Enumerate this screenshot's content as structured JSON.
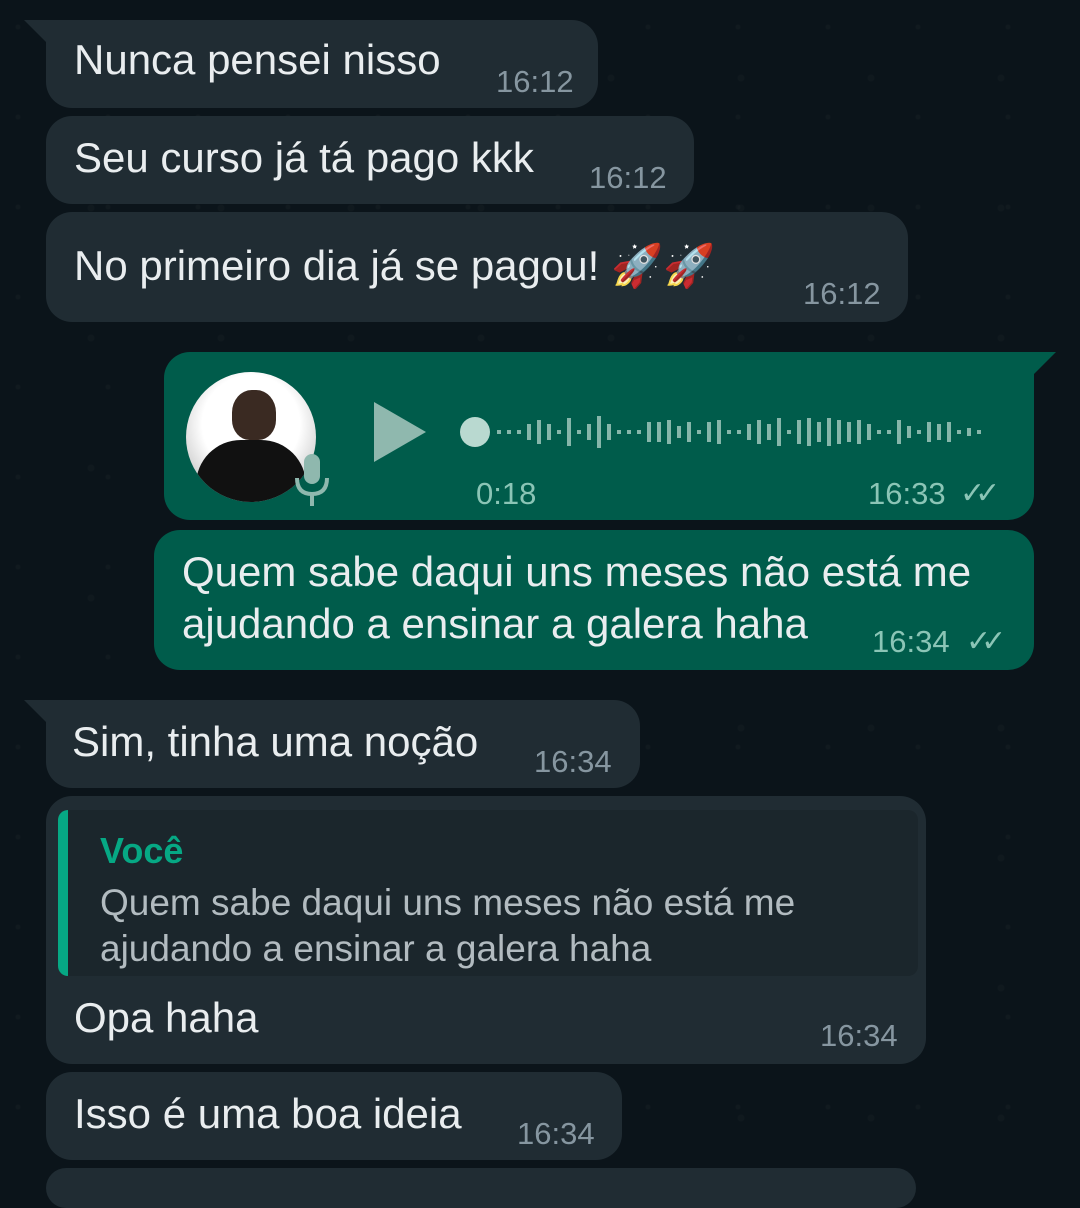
{
  "messages": {
    "m1": {
      "text": "Nunca pensei nisso",
      "time": "16:12"
    },
    "m2": {
      "text": "Seu curso já tá pago kkk",
      "time": "16:12"
    },
    "m3": {
      "text": "No primeiro dia já se pagou! 🚀🚀",
      "time": "16:12"
    },
    "voice": {
      "duration": "0:18",
      "time": "16:33",
      "status": "read"
    },
    "m4": {
      "line1": "Quem sabe daqui uns meses não está me",
      "line2": "ajudando a ensinar a galera haha",
      "time": "16:34",
      "status": "read"
    },
    "m5": {
      "text": "Sim, tinha uma noção",
      "time": "16:34"
    },
    "m6": {
      "reply_author": "Você",
      "reply_line1": "Quem sabe daqui uns meses não está me",
      "reply_line2": "ajudando a ensinar a galera haha",
      "text": "Opa haha",
      "time": "16:34"
    },
    "m7": {
      "text": "Isso é uma boa ideia",
      "time": "16:34"
    }
  },
  "icons": {
    "ticks": "✓✓",
    "play": "play-icon",
    "mic": "microphone-icon"
  },
  "colors": {
    "background": "#0b141a",
    "incoming_bubble": "#202c33",
    "outgoing_bubble": "#005c4b",
    "accent": "#06a884"
  }
}
